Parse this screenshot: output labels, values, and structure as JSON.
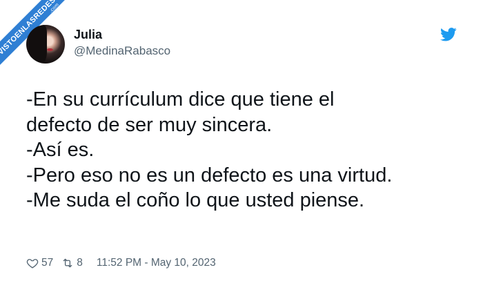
{
  "watermark": {
    "text": "VISTOENLASREDES",
    "suffix": ".com"
  },
  "author": {
    "name": "Julia",
    "handle": "@MedinaRabasco"
  },
  "icons": {
    "brand": "twitter-bird-icon",
    "like": "heart-icon",
    "retweet": "retweet-icon"
  },
  "tweet": {
    "lines": [
      "-En su currículum dice que tiene el",
      "defecto de ser muy sincera.",
      "-Así es.",
      "-Pero eso no es un defecto es una virtud.",
      "-Me suda el coño lo que usted piense."
    ]
  },
  "stats": {
    "likes": "57",
    "retweets": "8",
    "timestamp": "11:52 PM - May 10, 2023"
  },
  "colors": {
    "brand": "#1d9bf0",
    "text": "#0f1419",
    "muted": "#536471",
    "watermark": "#2f7fd4"
  }
}
